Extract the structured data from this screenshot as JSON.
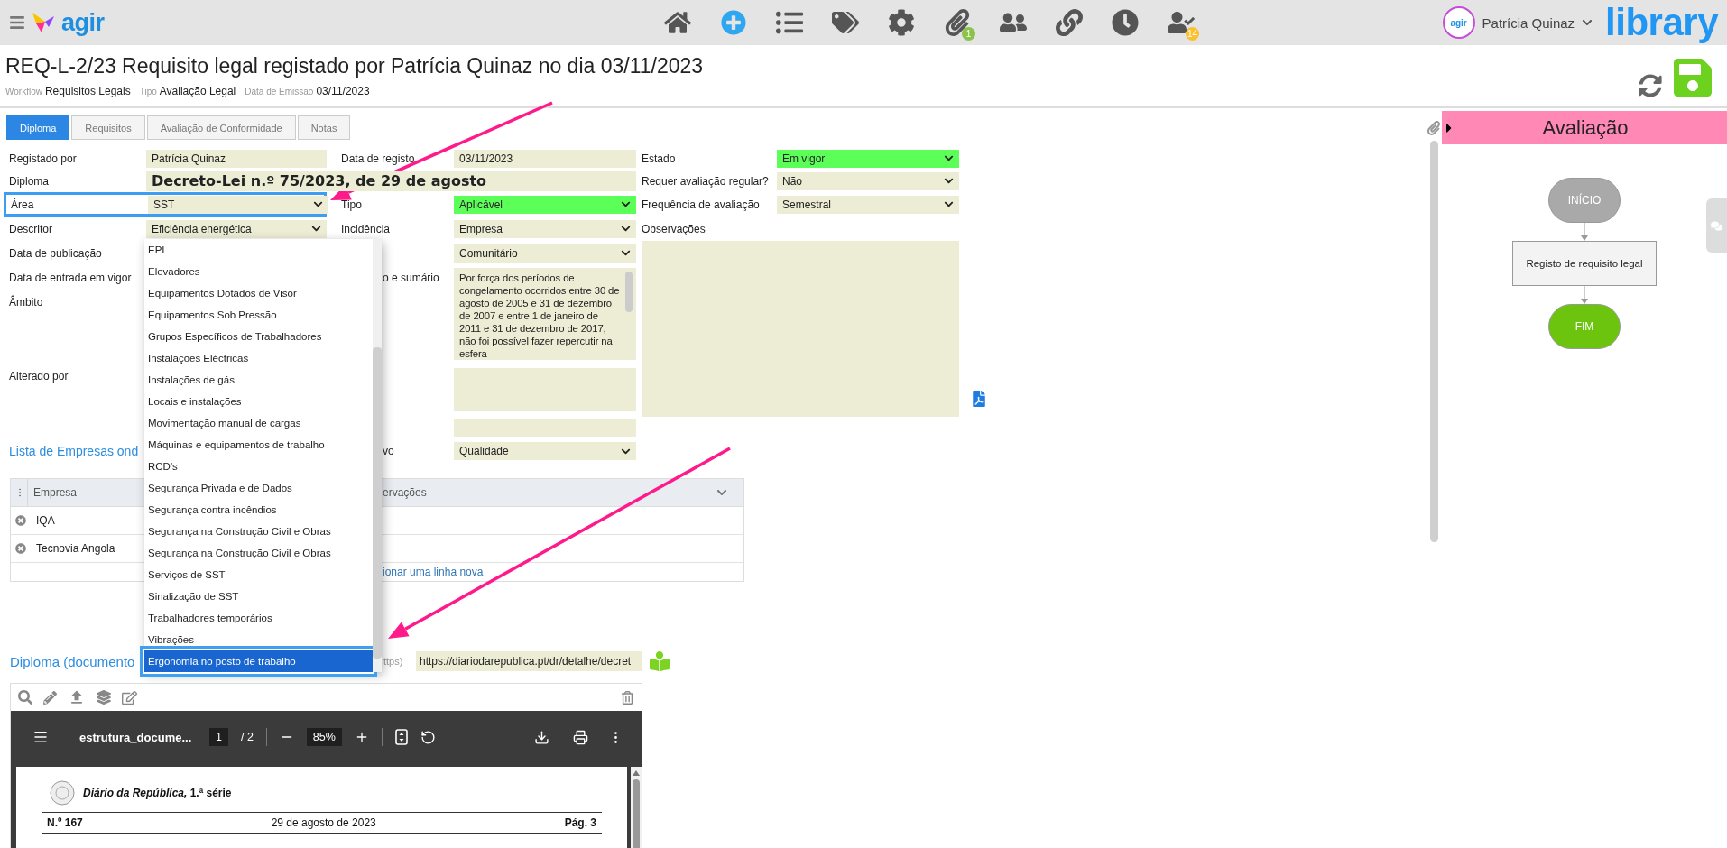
{
  "topbar": {
    "logo": "agir",
    "nav": [
      {
        "kind": "home"
      },
      {
        "kind": "add"
      },
      {
        "kind": "list"
      },
      {
        "kind": "tags"
      },
      {
        "kind": "settings"
      },
      {
        "kind": "attachments",
        "badge": "1",
        "color": "#8bc34a"
      },
      {
        "kind": "users"
      },
      {
        "kind": "links"
      },
      {
        "kind": "history"
      },
      {
        "kind": "tasks",
        "badge": "14",
        "color": "#fbc02d"
      }
    ],
    "user": {
      "avatar_text": "agir",
      "name": "Patrícia Quinaz"
    },
    "brand": "library"
  },
  "record": {
    "title": "REQ-L-2/23 Requisito legal registado por Patrícia Quinaz no dia 03/11/2023",
    "meta": [
      {
        "label": "Workflow",
        "value": "Requisitos Legais"
      },
      {
        "label": "Tipo",
        "value": "Avaliação Legal"
      },
      {
        "label": "Data de Emissão",
        "value": "03/11/2023"
      }
    ]
  },
  "tabs": [
    {
      "label": "Diploma",
      "selected": true
    },
    {
      "label": "Requisitos",
      "selected": false
    },
    {
      "label": "Avaliação de Conformidade",
      "selected": false
    },
    {
      "label": "Notas",
      "selected": false
    }
  ],
  "form": {
    "registado_por": {
      "label": "Registado por",
      "value": "Patrícia Quinaz"
    },
    "data_registo": {
      "label": "Data de registo",
      "value": "03/11/2023"
    },
    "estado": {
      "label": "Estado",
      "value": "Em vigor",
      "highlighted": true
    },
    "diploma": {
      "label": "Diploma",
      "value": "Decreto-Lei n.º 75/2023, de 29 de agosto"
    },
    "requer_avaliacao": {
      "label": "Requer avaliação regular?",
      "value": "Não",
      "highlighted": false
    },
    "area": {
      "label": "Área",
      "value": "SST",
      "focused": true
    },
    "tipo": {
      "label": "Tipo",
      "value": "Aplicável",
      "highlighted": true
    },
    "frequencia": {
      "label": "Frequência de avaliação",
      "value": "Semestral",
      "highlighted": false
    },
    "descritor": {
      "label": "Descritor",
      "value": "Eficiência energética"
    },
    "incidencia": {
      "label": "Incidência",
      "value": "Empresa",
      "highlighted": false
    },
    "observacoes": {
      "label": "Observações"
    },
    "data_publicacao": {
      "label": "Data de publicação"
    },
    "field_2_5": {
      "value": "Comunitário",
      "highlighted": false
    },
    "data_entrada": {
      "label": "Data de entrada em vigor"
    },
    "sumario": {
      "label_fragment": "o e sumário",
      "value": "Por força dos períodos de congelamento ocorridos entre 30 de agosto de 2005 e 31 de dezembro de 2007 e entre 1 de janeiro de 2011 e 31 de dezembro de 2017, não foi possível fazer repercutir na esfera"
    },
    "ambito": {
      "label": "Âmbito"
    },
    "alterado_por": {
      "label": "Alterado por"
    },
    "field_2_13": {
      "label_fragment": "vo",
      "value": "Qualidade",
      "highlighted": false
    }
  },
  "descritor_dropdown": {
    "options": [
      {
        "label": "EPI",
        "selected": false
      },
      {
        "label": "Elevadores",
        "selected": false
      },
      {
        "label": "Equipamentos Dotados de Visor",
        "selected": false
      },
      {
        "label": "Equipamentos Sob Pressão",
        "selected": false
      },
      {
        "label": "Grupos Específicos de Trabalhadores",
        "selected": false
      },
      {
        "label": "Instalações Eléctricas",
        "selected": false
      },
      {
        "label": "Instalações de gás",
        "selected": false
      },
      {
        "label": "Locais e instalações",
        "selected": false
      },
      {
        "label": "Movimentação manual de cargas",
        "selected": false
      },
      {
        "label": "Máquinas e equipamentos de trabalho",
        "selected": false
      },
      {
        "label": "RCD's",
        "selected": false
      },
      {
        "label": "Segurança Privada e de Dados",
        "selected": false
      },
      {
        "label": "Segurança contra incêndios",
        "selected": false
      },
      {
        "label": "Segurança na Construção Civil e Obras",
        "selected": false
      },
      {
        "label": "Segurança na Construção Civil e Obras",
        "selected": false
      },
      {
        "label": "Serviços de SST",
        "selected": false
      },
      {
        "label": "Sinalização de SST",
        "selected": false
      },
      {
        "label": "Trabalhadores temporários",
        "selected": false
      },
      {
        "label": "Vibrações",
        "selected": false
      },
      {
        "label": "Ergonomia no posto de trabalho",
        "selected": true
      }
    ]
  },
  "empresas": {
    "title_fragment": "Lista de Empresas ond",
    "column_1": "Empresa",
    "column_2_fragment": "ervações",
    "rows": [
      {
        "empresa": "IQA"
      },
      {
        "empresa": "Tecnovia Angola"
      }
    ],
    "add_link_fragment": "ionar uma linha nova"
  },
  "documento": {
    "label_fragment": "Diploma (documento",
    "hint_fragment": "ttps)",
    "url": "https://diariodarepublica.pt/dr/detalhe/decret"
  },
  "viewer": {
    "filename": "estrutura_docume...",
    "page": "1",
    "page_total": "/ 2",
    "zoom": "85%",
    "doc": {
      "journal": "*Diário da República,* 1.ª série",
      "number": "N.º 167",
      "date": "29 de agosto de 2023",
      "page": "Pág. 3"
    }
  },
  "workflow_panel": {
    "title": "Avaliação",
    "nodes": [
      {
        "kind": "start",
        "label": "INÍCIO"
      },
      {
        "kind": "task",
        "label": "Registo de requisito legal"
      },
      {
        "kind": "end",
        "label": "FIM"
      }
    ]
  }
}
